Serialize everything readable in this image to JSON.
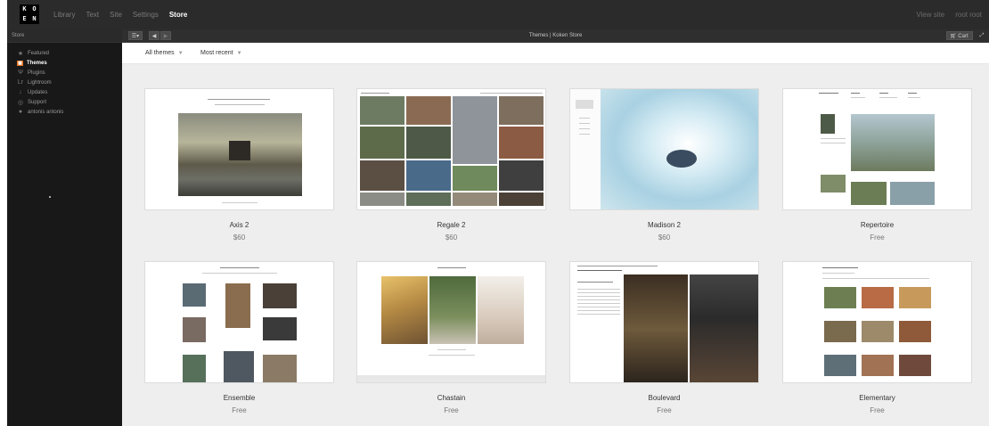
{
  "logo": {
    "letters": [
      "K",
      "O",
      "E",
      "N"
    ]
  },
  "topnav": {
    "items": [
      {
        "label": "Library",
        "active": false
      },
      {
        "label": "Text",
        "active": false
      },
      {
        "label": "Site",
        "active": false
      },
      {
        "label": "Settings",
        "active": false
      },
      {
        "label": "Store",
        "active": true
      }
    ],
    "right": [
      "View site",
      "root root"
    ]
  },
  "sidebar": {
    "header": "Store",
    "items": [
      {
        "label": "Featured",
        "icon": "star-icon",
        "active": false
      },
      {
        "label": "Themes",
        "icon": "themes-icon",
        "active": true
      },
      {
        "label": "Plugins",
        "icon": "plug-icon",
        "active": false
      },
      {
        "label": "Lightroom",
        "icon": "lightroom-icon",
        "active": false
      },
      {
        "label": "Updates",
        "icon": "download-icon",
        "active": false
      },
      {
        "label": "Support",
        "icon": "support-icon",
        "active": false
      },
      {
        "label": "antonis antonis",
        "icon": "user-icon",
        "active": false
      }
    ]
  },
  "toolbar": {
    "title": "Themes | Koken Store",
    "cart_label": "Cart"
  },
  "filters": {
    "category": "All themes",
    "sort": "Most recent"
  },
  "themes": [
    {
      "name": "Axis 2",
      "price": "$60"
    },
    {
      "name": "Regale 2",
      "price": "$60"
    },
    {
      "name": "Madison 2",
      "price": "$60"
    },
    {
      "name": "Repertoire",
      "price": "Free"
    },
    {
      "name": "Ensemble",
      "price": "Free"
    },
    {
      "name": "Chastain",
      "price": "Free"
    },
    {
      "name": "Boulevard",
      "price": "Free"
    },
    {
      "name": "Elementary",
      "price": "Free"
    }
  ],
  "colors": {
    "accent": "#e46f1c",
    "topbar": "#2b2b2b",
    "sidebar": "#181818",
    "content_bg": "#eeeeee"
  }
}
